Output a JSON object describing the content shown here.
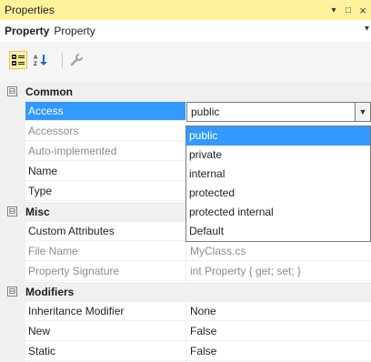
{
  "window": {
    "title": "Properties",
    "controls": {
      "dropdown": "▾",
      "maximize": "□",
      "close": "×"
    }
  },
  "object_selector": {
    "type_label": "Property",
    "name": "Property"
  },
  "toolbar": {
    "buttons": [
      {
        "name": "categorized",
        "icon": "categorized-icon",
        "active": true
      },
      {
        "name": "alphabetical",
        "icon": "sort-az-icon",
        "active": false
      },
      {
        "name": "property-pages",
        "icon": "wrench-icon",
        "active": false
      }
    ]
  },
  "grid": {
    "categories": [
      {
        "label": "Common",
        "toggle": "⊟",
        "rows": [
          {
            "name": "Access",
            "value": "public",
            "selected": true,
            "editor": "combo"
          },
          {
            "name": "Accessors",
            "value": "",
            "disabled": true
          },
          {
            "name": "Auto-implemented",
            "value": "",
            "disabled": true
          },
          {
            "name": "Name",
            "value": ""
          },
          {
            "name": "Type",
            "value": ""
          }
        ]
      },
      {
        "label": "Misc",
        "toggle": "⊟",
        "rows": [
          {
            "name": "Custom Attributes",
            "value": ""
          },
          {
            "name": "File Name",
            "value": "MyClass.cs",
            "disabled": true
          },
          {
            "name": "Property Signature",
            "value": "int Property { get; set; }",
            "disabled": true
          }
        ]
      },
      {
        "label": "Modifiers",
        "toggle": "⊟",
        "rows": [
          {
            "name": "Inheritance Modifier",
            "value": "None"
          },
          {
            "name": "New",
            "value": "False"
          },
          {
            "name": "Static",
            "value": "False"
          }
        ]
      }
    ]
  },
  "access_dropdown": {
    "options": [
      "public",
      "private",
      "internal",
      "protected",
      "protected internal",
      "Default"
    ],
    "selected": "public"
  },
  "colors": {
    "title_bar": "#fff29d",
    "selection": "#3399ff",
    "category_bg": "#f0f0f0",
    "disabled_text": "#8c8c8c"
  }
}
